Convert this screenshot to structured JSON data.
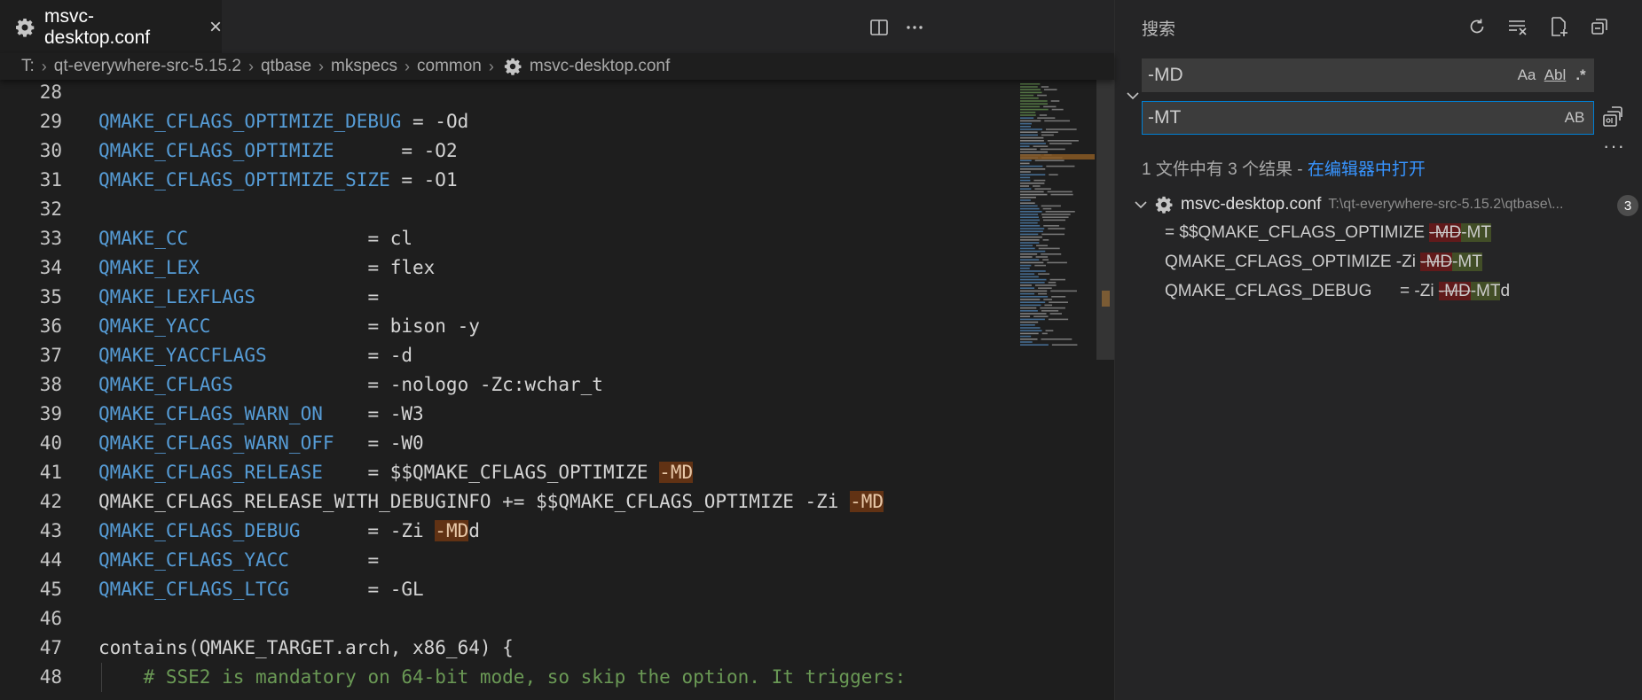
{
  "tab": {
    "title": "msvc-desktop.conf",
    "close": "×"
  },
  "breadcrumb": [
    "T:",
    "qt-everywhere-src-5.15.2",
    "qtbase",
    "mkspecs",
    "common",
    "msvc-desktop.conf"
  ],
  "code": [
    {
      "n": "28",
      "parts": []
    },
    {
      "n": "29",
      "parts": [
        [
          "k",
          "QMAKE_CFLAGS_OPTIMIZE_DEBUG"
        ],
        [
          "",
          " = -Od"
        ]
      ]
    },
    {
      "n": "30",
      "parts": [
        [
          "k",
          "QMAKE_CFLAGS_OPTIMIZE"
        ],
        [
          "",
          "      = -O2"
        ]
      ]
    },
    {
      "n": "31",
      "parts": [
        [
          "k",
          "QMAKE_CFLAGS_OPTIMIZE_SIZE"
        ],
        [
          "",
          " = -O1"
        ]
      ]
    },
    {
      "n": "32",
      "parts": []
    },
    {
      "n": "33",
      "parts": [
        [
          "k",
          "QMAKE_CC"
        ],
        [
          "",
          "                = cl"
        ]
      ]
    },
    {
      "n": "34",
      "parts": [
        [
          "k",
          "QMAKE_LEX"
        ],
        [
          "",
          "               = flex"
        ]
      ]
    },
    {
      "n": "35",
      "parts": [
        [
          "k",
          "QMAKE_LEXFLAGS"
        ],
        [
          "",
          "          ="
        ]
      ]
    },
    {
      "n": "36",
      "parts": [
        [
          "k",
          "QMAKE_YACC"
        ],
        [
          "",
          "              = bison -y"
        ]
      ]
    },
    {
      "n": "37",
      "parts": [
        [
          "k",
          "QMAKE_YACCFLAGS"
        ],
        [
          "",
          "         = -d"
        ]
      ]
    },
    {
      "n": "38",
      "parts": [
        [
          "k",
          "QMAKE_CFLAGS"
        ],
        [
          "",
          "            = -nologo -Zc:wchar_t"
        ]
      ]
    },
    {
      "n": "39",
      "parts": [
        [
          "k",
          "QMAKE_CFLAGS_WARN_ON"
        ],
        [
          "",
          "    = -W3"
        ]
      ]
    },
    {
      "n": "40",
      "parts": [
        [
          "k",
          "QMAKE_CFLAGS_WARN_OFF"
        ],
        [
          "",
          "   = -W0"
        ]
      ]
    },
    {
      "n": "41",
      "parts": [
        [
          "k",
          "QMAKE_CFLAGS_RELEASE"
        ],
        [
          "",
          "    = $$QMAKE_CFLAGS_OPTIMIZE "
        ],
        [
          "m",
          "-MD"
        ]
      ]
    },
    {
      "n": "42",
      "parts": [
        [
          "",
          "QMAKE_CFLAGS_RELEASE_WITH_DEBUGINFO += $$QMAKE_CFLAGS_OPTIMIZE -Zi "
        ],
        [
          "m",
          "-MD"
        ]
      ]
    },
    {
      "n": "43",
      "parts": [
        [
          "k",
          "QMAKE_CFLAGS_DEBUG"
        ],
        [
          "",
          "      = -Zi "
        ],
        [
          "m",
          "-MD"
        ],
        [
          "",
          "d"
        ]
      ]
    },
    {
      "n": "44",
      "parts": [
        [
          "k",
          "QMAKE_CFLAGS_YACC"
        ],
        [
          "",
          "       ="
        ]
      ]
    },
    {
      "n": "45",
      "parts": [
        [
          "k",
          "QMAKE_CFLAGS_LTCG"
        ],
        [
          "",
          "       = -GL"
        ]
      ]
    },
    {
      "n": "46",
      "parts": []
    },
    {
      "n": "47",
      "parts": [
        [
          "",
          "contains(QMAKE_TARGET.arch, x86_64) {"
        ]
      ]
    },
    {
      "n": "48",
      "parts": [
        [
          "",
          "    "
        ],
        [
          "c",
          "# SSE2 is mandatory on 64-bit mode, so skip the option. It triggers:"
        ]
      ]
    }
  ],
  "search": {
    "title": "搜索",
    "find_value": "-MD",
    "replace_value": "-MT",
    "opt_case": "Aa",
    "opt_word": "Abl",
    "opt_regex": ".*",
    "opt_preserve_case": "AB",
    "summary_prefix": "1 文件中有 3 个结果 - ",
    "open_in_editor": "在编辑器中打开",
    "file_name": "msvc-desktop.conf",
    "file_path": "T:\\qt-everywhere-src-5.15.2\\qtbase\\...",
    "match_count": "3",
    "results": [
      {
        "before": "= $$QMAKE_CFLAGS_OPTIMIZE ",
        "old": "-MD",
        "new": "-MT",
        "after": ""
      },
      {
        "before": "QMAKE_CFLAGS_OPTIMIZE -Zi ",
        "old": "-MD",
        "new": "-MT",
        "after": ""
      },
      {
        "before": "QMAKE_CFLAGS_DEBUG      = -Zi ",
        "old": "-MD",
        "new": "-MT",
        "after": "d"
      }
    ]
  },
  "colors": {
    "accent": "#007fd4",
    "link": "#3794ff",
    "keyword": "#569cd6",
    "comment": "#6a9955",
    "find_highlight": "#613214"
  },
  "icons": [
    "gear-icon",
    "close-icon",
    "split-editor-icon",
    "more-icon",
    "refresh-icon",
    "clear-results-icon",
    "new-search-editor-icon",
    "collapse-all-icon",
    "chevron-down-icon",
    "replace-all-icon"
  ]
}
